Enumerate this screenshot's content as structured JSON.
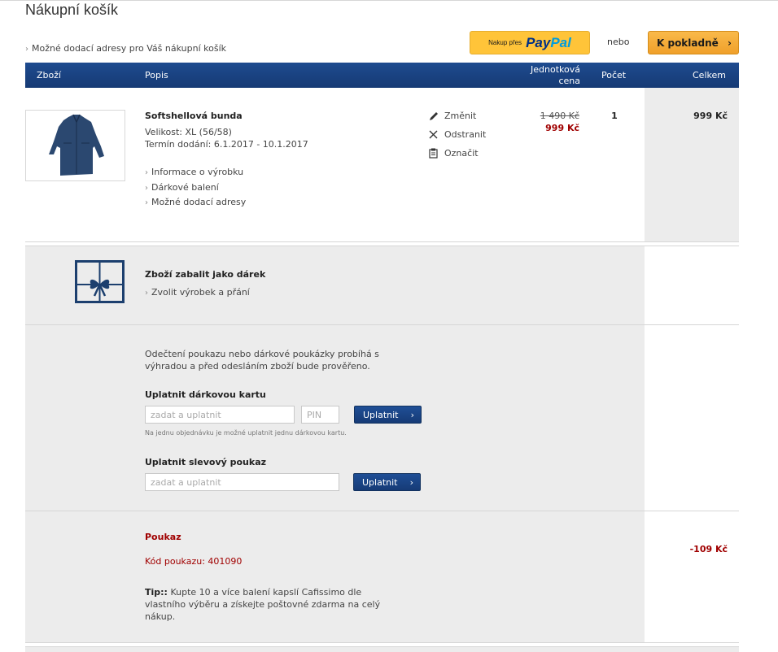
{
  "page": {
    "title": "Nákupní košík",
    "address_link": "Možné dodací adresy pro Váš nákupní košík"
  },
  "buttons": {
    "paypal_small": "Nakup přes",
    "paypal_logo_1": "Pay",
    "paypal_logo_2": "Pal",
    "or": "nebo",
    "checkout": "K pokladně"
  },
  "table_header": {
    "item": "Zboží",
    "description": "Popis",
    "unit_price_1": "Jednotková",
    "unit_price_2": "cena",
    "quantity": "Počet",
    "total": "Celkem"
  },
  "product": {
    "name": "Softshellová bunda",
    "size": "Velikost: XL (56/58)",
    "delivery": "Termín dodání: 6.1.2017 - 10.1.2017",
    "links": [
      "Informace o výrobku",
      "Dárkové balení",
      "Možné dodací adresy"
    ],
    "actions": [
      "Změnit",
      "Odstranit",
      "Označit"
    ],
    "old_price": "1 490 Kč",
    "new_price": "999 Kč",
    "quantity": "1",
    "line_total": "999 Kč"
  },
  "gift": {
    "title": "Zboží zabalit jako dárek",
    "link": "Zvolit výrobek a přání"
  },
  "vouchers": {
    "note": "Odečtení poukazu nebo dárkové poukázky probíhá s výhradou a před odesláním zboží bude prověřeno.",
    "gift_card_title": "Uplatnit dárkovou kartu",
    "gift_card_placeholder": "zadat a uplatnit",
    "pin_placeholder": "PIN",
    "apply_label": "Uplatnit",
    "gift_card_note": "Na jednu objednávku je možné uplatnit jednu dárkovou kartu.",
    "discount_title": "Uplatnit slevový poukaz",
    "discount_placeholder": "zadat a uplatnit"
  },
  "coupon": {
    "title": "Poukaz",
    "code": "Kód poukazu: 401090",
    "amount": "-109 Kč",
    "tip_label": "Tip::",
    "tip_text": "Kupte 10 a více balení kapslí Cafissimo dle vlastního výběru a získejte poštovné zdarma na celý nákup."
  },
  "colors": {
    "header_blue": "#1e4b8f",
    "checkout_orange": "#f5a623",
    "paypal_yellow": "#ffc439",
    "price_red": "#a00000",
    "gray_bg": "#ececec"
  }
}
